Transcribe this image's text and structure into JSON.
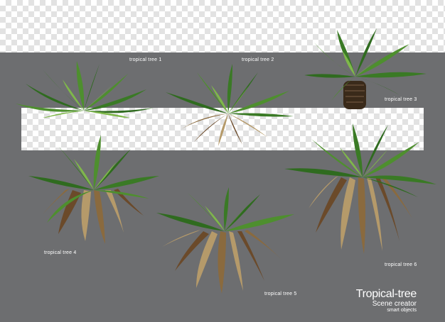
{
  "labels": {
    "tree1": "tropical  tree 1",
    "tree2": "tropical  tree 2",
    "tree3": "tropical  tree 3",
    "tree4": "tropical  tree 4",
    "tree5": "tropical  tree 5",
    "tree6": "tropical  tree 6"
  },
  "brand": {
    "title": "Tropical-tree",
    "subtitle": "Scene creator",
    "tagline": "smart objects"
  },
  "colors": {
    "background_gray": "#6d6e70",
    "leaf_dark": "#2f6b1f",
    "leaf_mid": "#4e8f2e",
    "leaf_light": "#7fb84a",
    "root_brown": "#6b4a2a",
    "root_tan": "#b59a6a"
  }
}
